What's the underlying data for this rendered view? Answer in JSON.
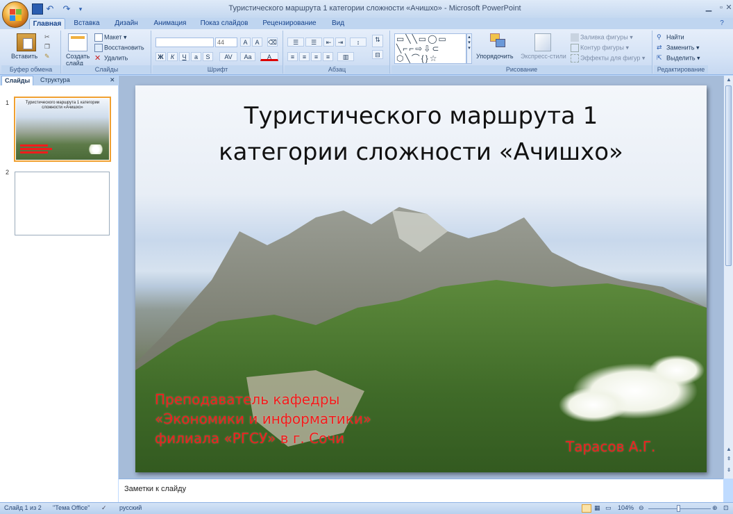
{
  "window": {
    "title": "Туристического маршрута 1 категории сложности «Ачишхо» - Microsoft PowerPoint"
  },
  "tabs": [
    {
      "label": "Главная",
      "active": true
    },
    {
      "label": "Вставка",
      "active": false
    },
    {
      "label": "Дизайн",
      "active": false
    },
    {
      "label": "Анимация",
      "active": false
    },
    {
      "label": "Показ слайдов",
      "active": false
    },
    {
      "label": "Рецензирование",
      "active": false
    },
    {
      "label": "Вид",
      "active": false
    }
  ],
  "ribbon": {
    "clipboard": {
      "label": "Буфер обмена",
      "paste": "Вставить"
    },
    "slides": {
      "label": "Слайды",
      "create": "Создать слайд",
      "layout": "Макет",
      "reset": "Восстановить",
      "delete": "Удалить"
    },
    "font": {
      "label": "Шрифт",
      "size": "44"
    },
    "paragraph": {
      "label": "Абзац"
    },
    "drawing": {
      "label": "Рисование",
      "arrange": "Упорядочить",
      "quick_styles": "Экспресс-стили",
      "fill": "Заливка фигуры",
      "outline": "Контур фигуры",
      "effects": "Эффекты для фигур"
    },
    "editing": {
      "label": "Редактирование",
      "find": "Найти",
      "replace": "Заменить",
      "select": "Выделить"
    }
  },
  "left_panel": {
    "tabs": [
      {
        "label": "Слайды",
        "active": true
      },
      {
        "label": "Структура",
        "active": false
      }
    ],
    "thumbnails": [
      {
        "number": "1",
        "title": "Туристического маршрута 1 категории сложности «Ачишхо»"
      },
      {
        "number": "2",
        "title": ""
      }
    ]
  },
  "slide": {
    "title": "Туристического маршрута 1\nкатегории сложности «Ачишхо»",
    "author_lines": [
      "Преподаватель кафедры",
      "«Экономики и информатики»",
      "филиала «РГСУ» в г. Сочи"
    ],
    "author_name": "Тарасов А.Г."
  },
  "notes": {
    "placeholder": "Заметки к слайду"
  },
  "statusbar": {
    "slide_info": "Слайд 1 из 2",
    "theme": "\"Тема Office\"",
    "language": "русский",
    "zoom": "104%"
  },
  "colors": {
    "accent_red": "#f21c1c",
    "ribbon_blue": "#d5e3f6",
    "selection_orange": "#f0a030"
  }
}
